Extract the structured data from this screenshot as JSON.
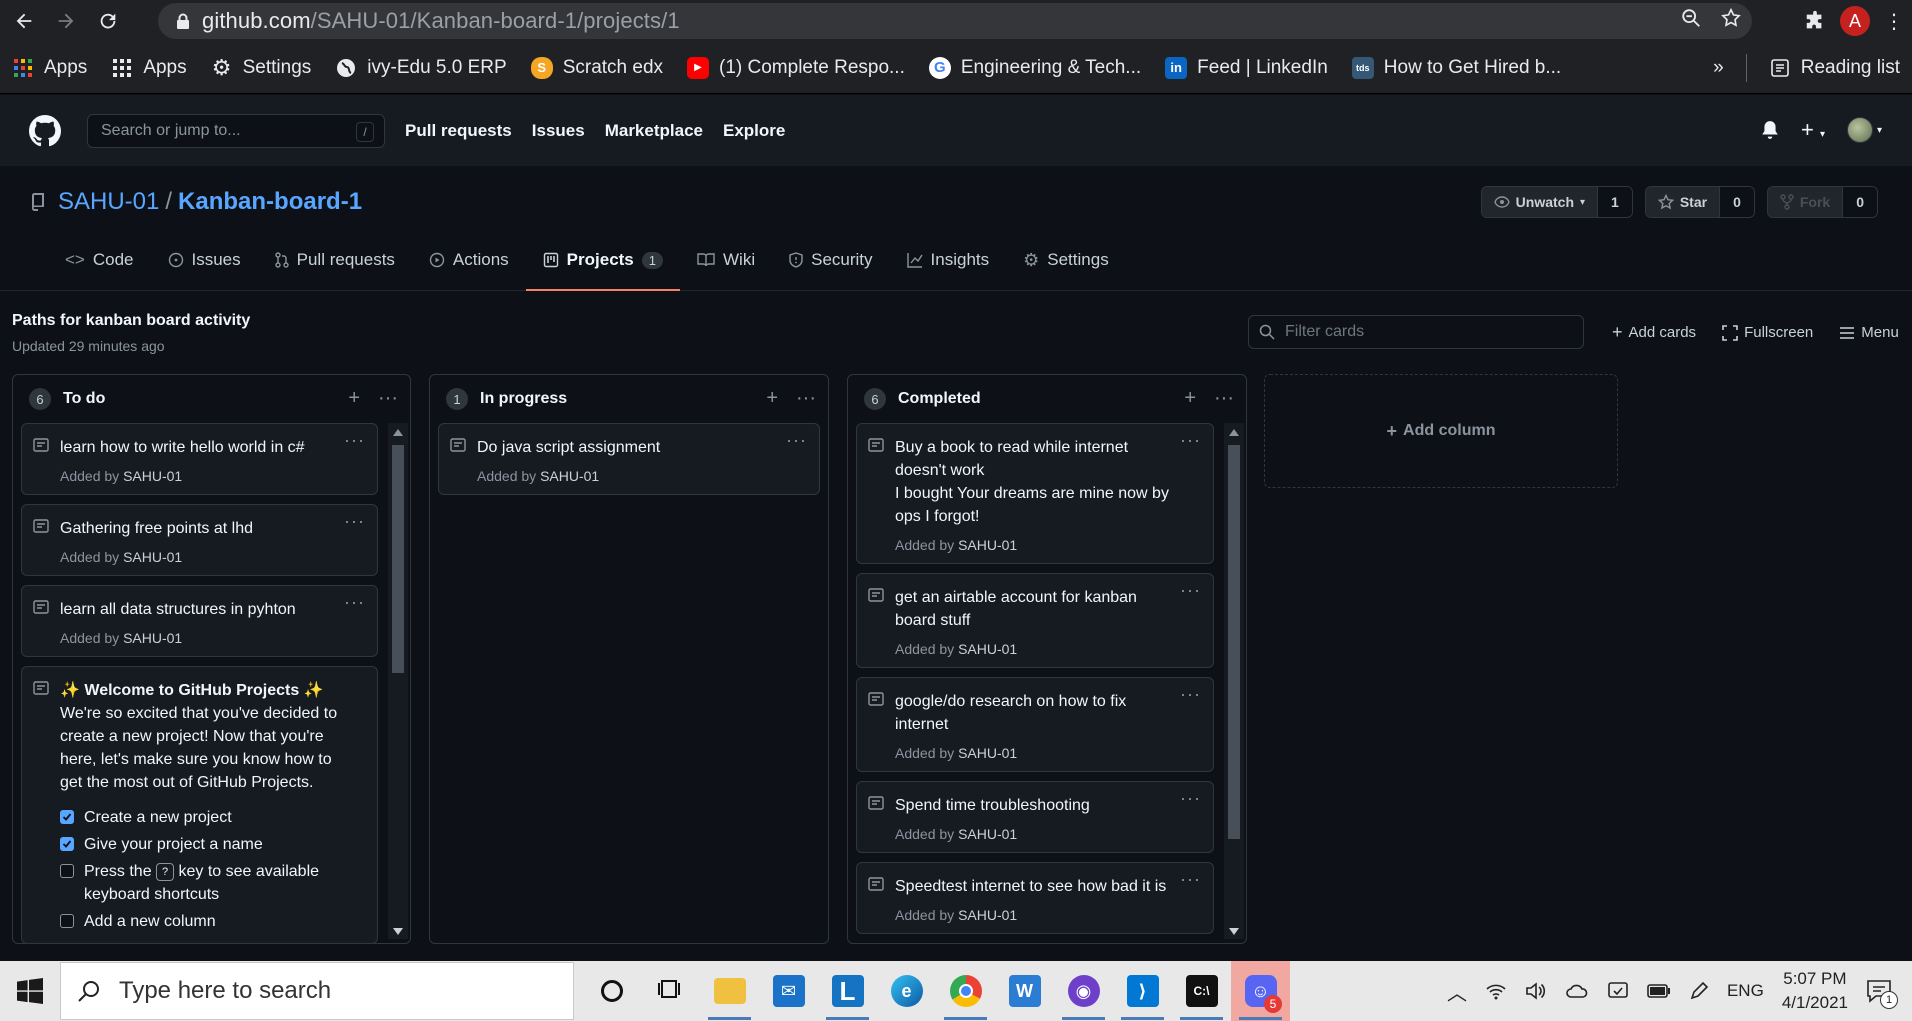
{
  "browser": {
    "url_host": "github.com",
    "url_path": "/SAHU-01/Kanban-board-1/projects/1",
    "avatar_letter": "A",
    "bookmarks": [
      {
        "label": "Apps",
        "icon": "apps-grid-color-icon"
      },
      {
        "label": "Apps",
        "icon": "apps-grid-icon"
      },
      {
        "label": "Settings",
        "icon": "gear-icon"
      },
      {
        "label": "ivy-Edu 5.0 ERP",
        "icon": "globe-icon"
      },
      {
        "label": "Scratch edx",
        "icon": "scratch-icon"
      },
      {
        "label": "(1) Complete Respo...",
        "icon": "youtube-icon"
      },
      {
        "label": "Engineering & Tech...",
        "icon": "google-icon"
      },
      {
        "label": "Feed | LinkedIn",
        "icon": "linkedin-icon"
      },
      {
        "label": "How to Get Hired b...",
        "icon": "tds-icon"
      }
    ],
    "more_label": "»",
    "reading_list": "Reading list"
  },
  "gh": {
    "search_placeholder": "Search or jump to...",
    "search_key": "/",
    "nav": [
      "Pull requests",
      "Issues",
      "Marketplace",
      "Explore"
    ]
  },
  "repo": {
    "owner": "SAHU-01",
    "sep": "/",
    "name": "Kanban-board-1",
    "unwatch_label": "Unwatch",
    "unwatch_count": "1",
    "star_label": "Star",
    "star_count": "0",
    "fork_label": "Fork",
    "fork_count": "0",
    "tabs": [
      {
        "label": "Code"
      },
      {
        "label": "Issues"
      },
      {
        "label": "Pull requests"
      },
      {
        "label": "Actions"
      },
      {
        "label": "Projects",
        "badge": "1"
      },
      {
        "label": "Wiki"
      },
      {
        "label": "Security"
      },
      {
        "label": "Insights"
      },
      {
        "label": "Settings"
      }
    ]
  },
  "project": {
    "title": "Paths for kanban board activity",
    "updated": "Updated 29 minutes ago",
    "filter_placeholder": "Filter cards",
    "add_cards": "Add cards",
    "fullscreen": "Fullscreen",
    "menu": "Menu",
    "add_column": "Add column",
    "added_by_prefix": "Added by",
    "columns": [
      {
        "name": "To do",
        "count": "6",
        "cards": [
          {
            "title": "learn how to write hello world in c#",
            "author": "SAHU-01"
          },
          {
            "title": "Gathering free points at lhd",
            "author": "SAHU-01"
          },
          {
            "title": "learn all data structures in pyhton",
            "author": "SAHU-01"
          }
        ],
        "welcome": {
          "title": "Welcome to GitHub Projects",
          "body": "We're so excited that you've decided to create a new project! Now that you're here, let's make sure you know how to get the most out of GitHub Projects.",
          "checklist": [
            {
              "text": "Create a new project",
              "checked": true
            },
            {
              "text": "Give your project a name",
              "checked": true
            },
            {
              "pre": "Press the",
              "key": "?",
              "post": "key to see available keyboard shortcuts",
              "checked": false
            },
            {
              "text": "Add a new column",
              "checked": false
            }
          ]
        }
      },
      {
        "name": "In progress",
        "count": "1",
        "cards": [
          {
            "title": "Do java script assignment",
            "author": "SAHU-01"
          }
        ]
      },
      {
        "name": "Completed",
        "count": "6",
        "cards": [
          {
            "title": "Buy a book to read while internet doesn't work",
            "note": "I bought Your dreams are mine now by ops I forgot!",
            "author": "SAHU-01"
          },
          {
            "title": "get an airtable account for kanban board stuff",
            "author": "SAHU-01"
          },
          {
            "title": "google/do research on how to fix internet",
            "author": "SAHU-01"
          },
          {
            "title": "Spend time troubleshooting",
            "author": "SAHU-01"
          },
          {
            "title": "Speedtest internet to see how bad it is",
            "author": "SAHU-01"
          }
        ]
      }
    ]
  },
  "taskbar": {
    "search_placeholder": "Type here to search",
    "lang": "ENG",
    "time": "5:07 PM",
    "date": "4/1/2021",
    "discord_badge": "5",
    "notif_badge": "1"
  },
  "colors": {
    "bg": "#0d1117",
    "header": "#161b22",
    "link": "#58a6ff",
    "active_tab": "#f78166"
  }
}
